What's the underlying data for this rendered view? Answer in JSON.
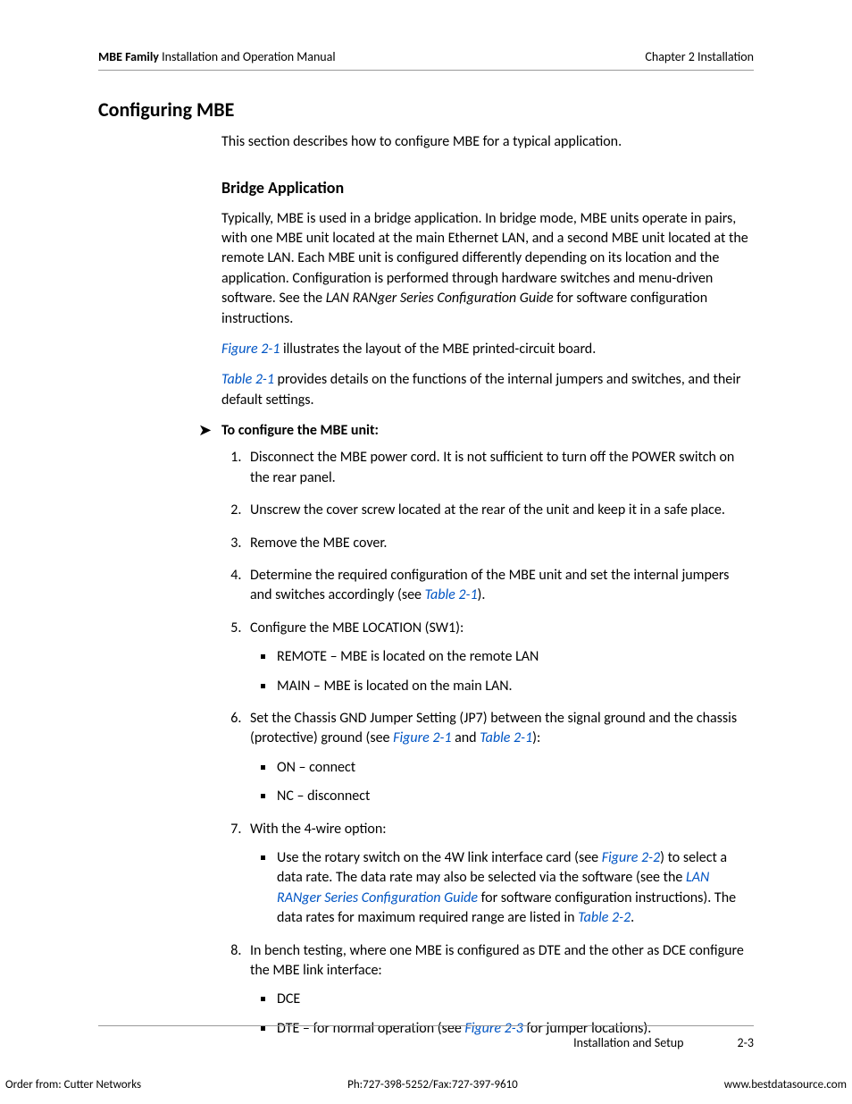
{
  "header": {
    "doc_title_bold": "MBE Family",
    "doc_title_rest": " Installation and Operation Manual",
    "chapter": "Chapter 2  Installation"
  },
  "h1": "Configuring MBE",
  "intro": "This section describes how to configure MBE for a typical application.",
  "h2": "Bridge Application",
  "bridge_p1_a": "Typically, MBE is used in a bridge application. In bridge mode, MBE units operate in pairs, with one MBE unit located at the main Ethernet LAN, and a second MBE unit located at the remote LAN. Each MBE unit is configured differently depending on its location and the application. Configuration is performed through hardware switches and menu-driven software. See the ",
  "bridge_p1_ital": "LAN RANger Series Configuration Guide",
  "bridge_p1_b": " for software configuration instructions.",
  "fig21_ref": "Figure 2-1",
  "fig21_rest": " illustrates the layout of the MBE printed-circuit board.",
  "tab21_ref": "Table 2-1",
  "tab21_rest": " provides details on the functions of the internal jumpers and switches, and their default settings.",
  "proc_title": "To configure  the MBE unit:",
  "steps": {
    "s1": "Disconnect the MBE power cord. It is not sufficient to turn off the POWER switch on the rear panel.",
    "s2": "Unscrew the cover screw located at the rear of the unit and keep it in a safe place.",
    "s3": "Remove the MBE cover.",
    "s4_a": "Determine the required configuration of the MBE unit and set the internal jumpers and switches accordingly (see ",
    "s4_ref": "Table 2-1",
    "s4_b": ").",
    "s5": "Configure the MBE LOCATION (SW1):",
    "s5_b1": "REMOTE – MBE is located on the remote LAN",
    "s5_b2": "MAIN – MBE is located on the main LAN.",
    "s6_a": "Set the Chassis GND Jumper Setting  (JP7) between the signal ground and the chassis (protective) ground (see ",
    "s6_ref1": "Figure 2-1",
    "s6_mid": " and ",
    "s6_ref2": "Table 2-1",
    "s6_b": "):",
    "s6_b1": " ON – connect",
    "s6_b2": " NC – disconnect",
    "s7": "With the 4-wire option:",
    "s7_b1_a": "Use the rotary switch on the 4W link interface card (see ",
    "s7_b1_ref1": "Figure 2-2",
    "s7_b1_mid1": ") to select a data rate. The data rate may also be selected via the software (see the ",
    "s7_b1_ital": "LAN RANger Series Configuration Guide",
    "s7_b1_mid2": " for software configuration instructions). The data rates for maximum required range are listed in ",
    "s7_b1_ref2": "Table 2-2",
    "s7_b1_end": ".",
    "s8": "In bench testing, where one MBE is configured as DTE and the other as DCE configure the MBE link interface:",
    "s8_b1": "DCE",
    "s8_b2_a": "DTE – for normal operation (see ",
    "s8_b2_ref": "Figure 2-3",
    "s8_b2_b": " for jumper locations)."
  },
  "footer": {
    "section": "Installation and Setup",
    "page": "2-3"
  },
  "order": {
    "left": "Order from: Cutter Networks",
    "mid": "Ph:727-398-5252/Fax:727-397-9610",
    "right": "www.bestdatasource.com"
  }
}
